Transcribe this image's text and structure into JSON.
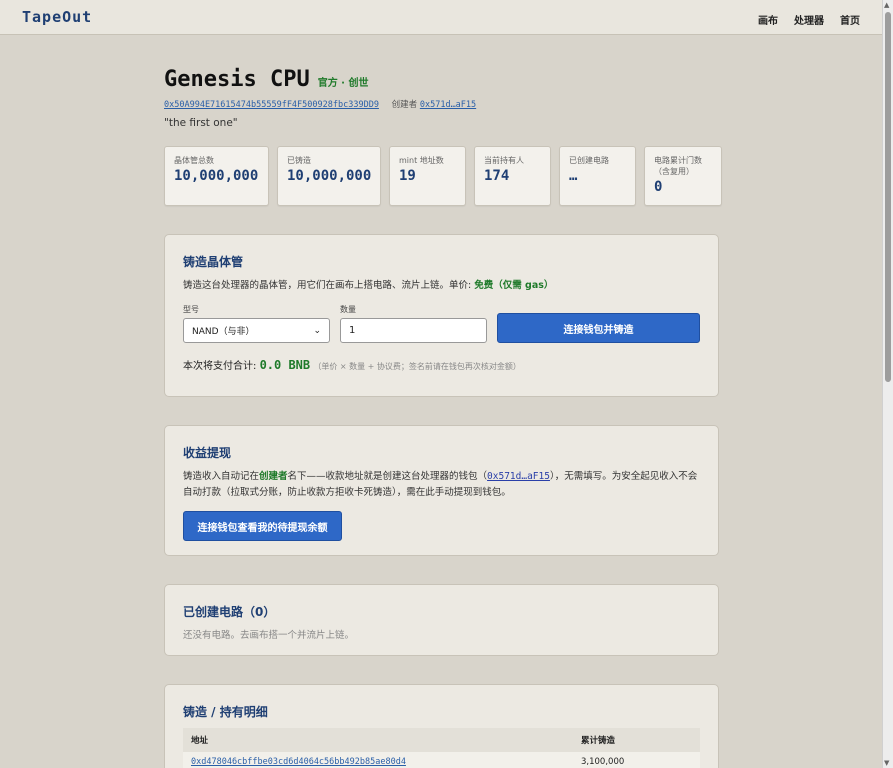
{
  "app": {
    "brand": "TapeOut",
    "nav": [
      "画布",
      "处理器",
      "首页"
    ]
  },
  "processor": {
    "name": "Genesis CPU",
    "badges": "官方 · 创世",
    "address": "0x50A994E71615474b55559fF4F500928fbc339DD9",
    "creator_label": "创建者",
    "creator_short": "0x571d…aF15",
    "quote": "\"the first one\""
  },
  "stats": [
    {
      "label": "晶体管总数",
      "value": "10,000,000"
    },
    {
      "label": "已铸造",
      "value": "10,000,000"
    },
    {
      "label": "mint 地址数",
      "value": "19"
    },
    {
      "label": "当前持有人",
      "value": "174"
    },
    {
      "label": "已创建电路",
      "value": "…"
    },
    {
      "label": "电路累计门数（含复用）",
      "value": "0"
    }
  ],
  "mint": {
    "title": "铸造晶体管",
    "desc": "铸造这台处理器的晶体管，用它们在画布上搭电路、流片上链。单价:",
    "price": "免费（仅需 gas）",
    "model_label": "型号",
    "model_value": "NAND（与非）",
    "qty_label": "数量",
    "qty_value": "1",
    "button": "连接钱包并铸造",
    "total_label": "本次将支付合计:",
    "total_value": "0.0 BNB",
    "total_hint": "（单价 × 数量 + 协议费；签名前请在钱包再次核对金额）"
  },
  "withdraw": {
    "title": "收益提现",
    "desc_1": "铸造收入自动记在",
    "desc_creator": "创建者",
    "desc_2": "名下——收款地址就是创建这台处理器的钱包（",
    "desc_addr": "0x571d…aF15",
    "desc_3": "），无需填写。为安全起见收入不会自动打款（拉取式分账，防止收款方拒收卡死铸造），需在此手动提现到钱包。",
    "button": "连接钱包查看我的待提现余额"
  },
  "circuits": {
    "title": "已创建电路（0）",
    "empty": "还没有电路。去画布搭一个并流片上链。"
  },
  "holders": {
    "title": "铸造 / 持有明细",
    "col_address": "地址",
    "col_minted": "累计铸造",
    "rows": [
      {
        "address": "0xd478046cbffbe03cd6d4064c56bb492b85ae80d4",
        "minted": "3,100,000"
      }
    ]
  }
}
